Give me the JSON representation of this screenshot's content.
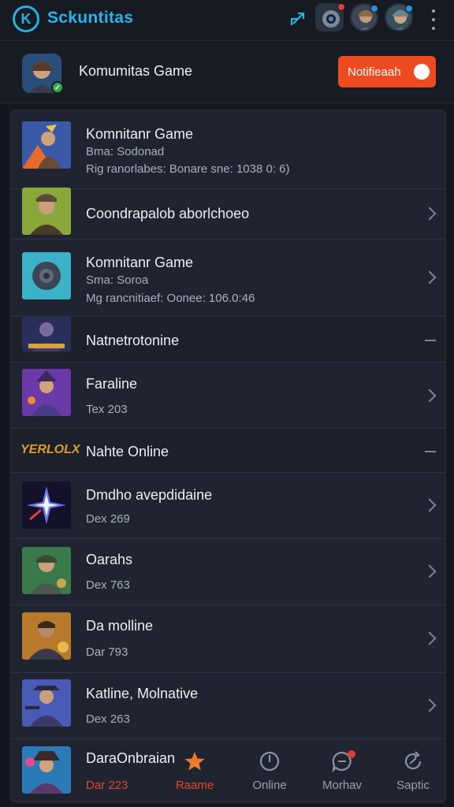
{
  "app": {
    "title": "Sckuntitas",
    "logo_letter": "K"
  },
  "topbar": {
    "icons": [
      "share-icon",
      "avatar",
      "avatar",
      "avatar",
      "more-icon"
    ]
  },
  "header": {
    "title": "Komumitas Game",
    "notification_label": "Notifieaah",
    "notification_toggle_on": true
  },
  "list": {
    "rows": [
      {
        "title": "Komnitanr Game",
        "sub": "Bma: Sodonad",
        "sub2": "Rig ranorlabes: Bonare sne: 1038 0: 6)",
        "accessory": "none"
      },
      {
        "title": "Coondrapalob aborlchoeo",
        "accessory": "chevron"
      },
      {
        "title": "Komnitanr Game",
        "sub": "Sma: Soroa",
        "sub2": "Mg rancnitiaef: Oonee: 106.0:46",
        "accessory": "chevron"
      },
      {
        "title": "Natnetrotonine",
        "accessory": "dash",
        "section": true
      },
      {
        "title": "Faraline",
        "sub": "Tex 203",
        "accessory": "chevron"
      },
      {
        "title": "Nahte Online",
        "brand_text": "YERLOLX",
        "accessory": "dash",
        "section": true
      },
      {
        "title": "Dmdho avepdidaine",
        "sub": "Dex 269",
        "accessory": "chevron"
      },
      {
        "title": "Oarahs",
        "sub": "Dex 763",
        "accessory": "chevron"
      },
      {
        "title": "Da molline",
        "sub": "Dar 793",
        "accessory": "chevron"
      },
      {
        "title": "Katline, Molnative",
        "sub": "Dex 263",
        "accessory": "chevron"
      },
      {
        "title": "DaraOnbraian",
        "sub": "Dar 223",
        "accessory": "none"
      }
    ]
  },
  "bottom_nav": {
    "items": [
      {
        "label": "Raame",
        "icon": "star-icon",
        "active": true
      },
      {
        "label": "Online",
        "icon": "power-icon",
        "active": false
      },
      {
        "label": "Morhav",
        "icon": "chat-icon",
        "active": false,
        "badge": true
      },
      {
        "label": "Saptic",
        "icon": "refresh-icon",
        "active": false
      }
    ]
  },
  "colors": {
    "accent": "#27b6ee",
    "notification": "#ee4a22",
    "nav_active": "#e8452a",
    "background": "#14171d",
    "card": "#1f2430"
  }
}
